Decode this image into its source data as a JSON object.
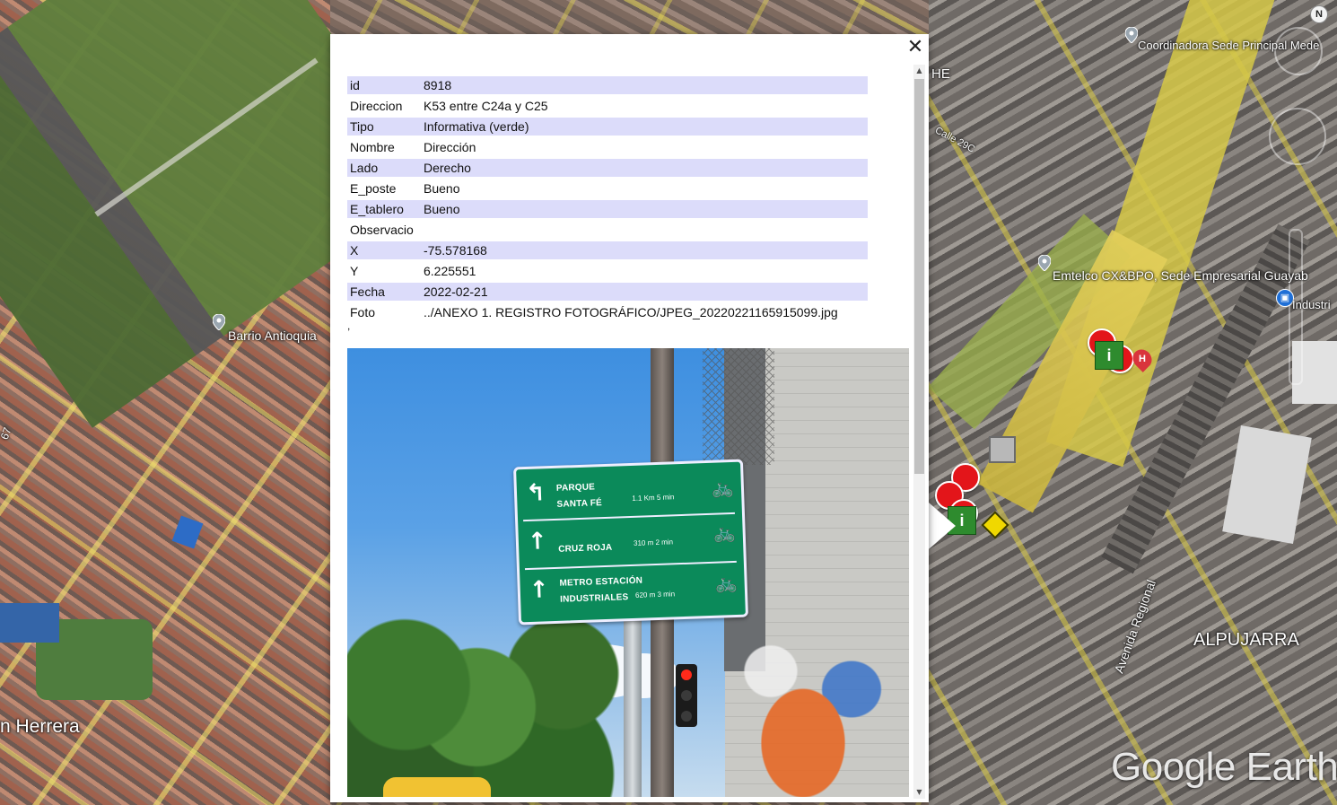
{
  "map": {
    "labels": {
      "coordinadora": "Coordinadora Sede Principal Mede",
      "calle": "Calle 29C",
      "he": "HE",
      "emtelco": "Emtelco CX&BPO, Sede Empresarial Guayab",
      "industri": "Industri",
      "barrio": "Barrio Antioquia",
      "herrera": "n Herrera",
      "avenida": "Avenida Regional",
      "alpujarra": "ALPUJARRA",
      "road_num": "67"
    },
    "compass_label": "N",
    "watermark": "Google Earth",
    "hospital_label": "H",
    "info_marker_label": "i"
  },
  "balloon": {
    "close_label": "✕",
    "rows": [
      {
        "key": "id",
        "value": "8918"
      },
      {
        "key": "Direccion",
        "value": "K53 entre C24a y C25"
      },
      {
        "key": "Tipo",
        "value": "Informativa (verde)"
      },
      {
        "key": "Nombre",
        "value": "Dirección"
      },
      {
        "key": "Lado",
        "value": "Derecho"
      },
      {
        "key": "E_poste",
        "value": "Bueno"
      },
      {
        "key": "E_tablero",
        "value": "Bueno"
      },
      {
        "key": "Observacio",
        "value": ""
      },
      {
        "key": "X",
        "value": "-75.578168"
      },
      {
        "key": "Y",
        "value": "6.225551"
      },
      {
        "key": "Fecha",
        "value": "2022-02-21"
      },
      {
        "key": "Foto",
        "value": "../ANEXO 1. REGISTRO FOTOGRÁFICO/JPEG_20220221165915099.jpg"
      }
    ],
    "trailing_text": ",",
    "photo_sign": {
      "rows": [
        {
          "name_line1": "PARQUE",
          "name_line2": "SANTA FÉ",
          "distance": "1.1 Km  5 min",
          "arrow": "↰"
        },
        {
          "name_line1": "",
          "name_line2": "CRUZ ROJA",
          "distance": "310 m  2 min",
          "arrow": "↑"
        },
        {
          "name_line1": "METRO ESTACIÓN",
          "name_line2": "INDUSTRIALES",
          "distance": "620 m  3 min",
          "arrow": "↑"
        }
      ],
      "bike_icon": "🚲"
    }
  },
  "scrollbar": {
    "up_arrow": "▲",
    "down_arrow": "▼"
  }
}
